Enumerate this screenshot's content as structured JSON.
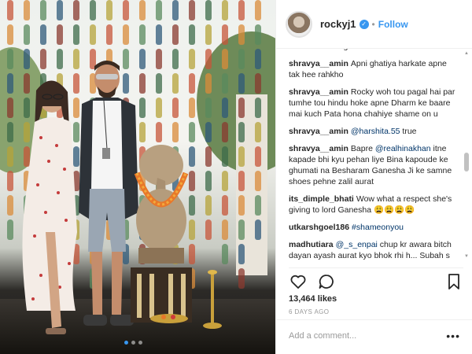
{
  "post": {
    "username": "rockyj1",
    "verified_icon": "verified-check-icon",
    "separator": "•",
    "follow_label": "Follow",
    "likes": "13,464 likes",
    "time_ago": "6 DAYS AGO",
    "add_comment_placeholder": "Add a comment...",
    "more_label": "•••",
    "carousel_dots": 3,
    "carousel_active": 0
  },
  "comments": [
    {
      "user": "",
      "parts": [
        {
          "t": "nahi hota. You get well soon."
        }
      ]
    },
    {
      "user": "shravya__amin",
      "parts": [
        {
          "t": "Apni ghatiya harkate apne tak hee rahkho"
        }
      ]
    },
    {
      "user": "shravya__amin",
      "parts": [
        {
          "t": "Rocky woh tou pagal hai par tumhe tou hindu hoke apne Dharm ke baare mai kuch Pata hona chahiye shame on u"
        }
      ]
    },
    {
      "user": "shravya__amin",
      "parts": [
        {
          "t": "@harshita.55",
          "m": true
        },
        {
          "t": " true"
        }
      ]
    },
    {
      "user": "shravya__amin",
      "parts": [
        {
          "t": "Bapre "
        },
        {
          "t": "@realhinakhan",
          "m": true
        },
        {
          "t": " itne kapade bhi kyu pehan liye Bina kapoude ke ghumati na Besharam Ganesha Ji ke samne shoes pehne zalil aurat"
        }
      ]
    },
    {
      "user": "its_dimple_bhati",
      "parts": [
        {
          "t": "Wow what a respect she's giving to lord Ganesha 😩😩😩😩"
        }
      ]
    },
    {
      "user": "utkarshgoel186",
      "parts": [
        {
          "t": "#shameonyou",
          "m": true
        }
      ]
    },
    {
      "user": "madhutiara",
      "parts": [
        {
          "t": "@_s_enpai",
          "m": true
        },
        {
          "t": " chup kr awara bitch dayan ayash aurat kyo bhok rhi h... Subah s muh mar ldko s.. Foktiya or koi kam nhi tere pas"
        }
      ]
    }
  ],
  "colors": {
    "link": "#3897f0",
    "mention": "#003569",
    "text": "#262626",
    "muted": "#999999"
  }
}
